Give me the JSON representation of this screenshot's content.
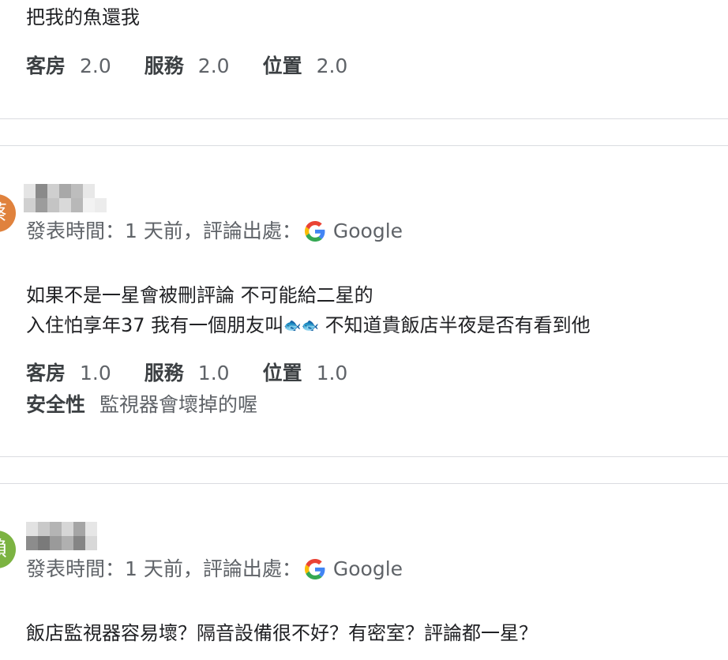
{
  "reviews": [
    {
      "text_lines": [
        "把我的魚還我"
      ],
      "ratings": [
        {
          "label": "客房",
          "value": "2.0"
        },
        {
          "label": "服務",
          "value": "2.0"
        },
        {
          "label": "位置",
          "value": "2.0"
        }
      ]
    },
    {
      "avatar_char": "蔡",
      "avatar_color": "#e0823d",
      "meta_prefix": "發表時間：1 天前，評論出處：",
      "source": "Google",
      "text_line1": "如果不是一星會被刪評論 不可能給二星的",
      "text_line2_before": "入住怕享年37 我有一個朋友叫",
      "fish_emoji": "🐟🐟",
      "text_line2_after": " 不知道貴飯店半夜是否有看到他",
      "ratings": [
        {
          "label": "客房",
          "value": "1.0"
        },
        {
          "label": "服務",
          "value": "1.0"
        },
        {
          "label": "位置",
          "value": "1.0"
        }
      ],
      "extra_rating": {
        "label": "安全性",
        "value": "監視器會壞掉的喔"
      }
    },
    {
      "avatar_char": "賴",
      "avatar_color": "#7cb342",
      "meta_prefix": "發表時間：1 天前，評論出處：",
      "source": "Google",
      "text_line1": "飯店監視器容易壞？隔音設備很不好？有密室？評論都一星？"
    }
  ]
}
